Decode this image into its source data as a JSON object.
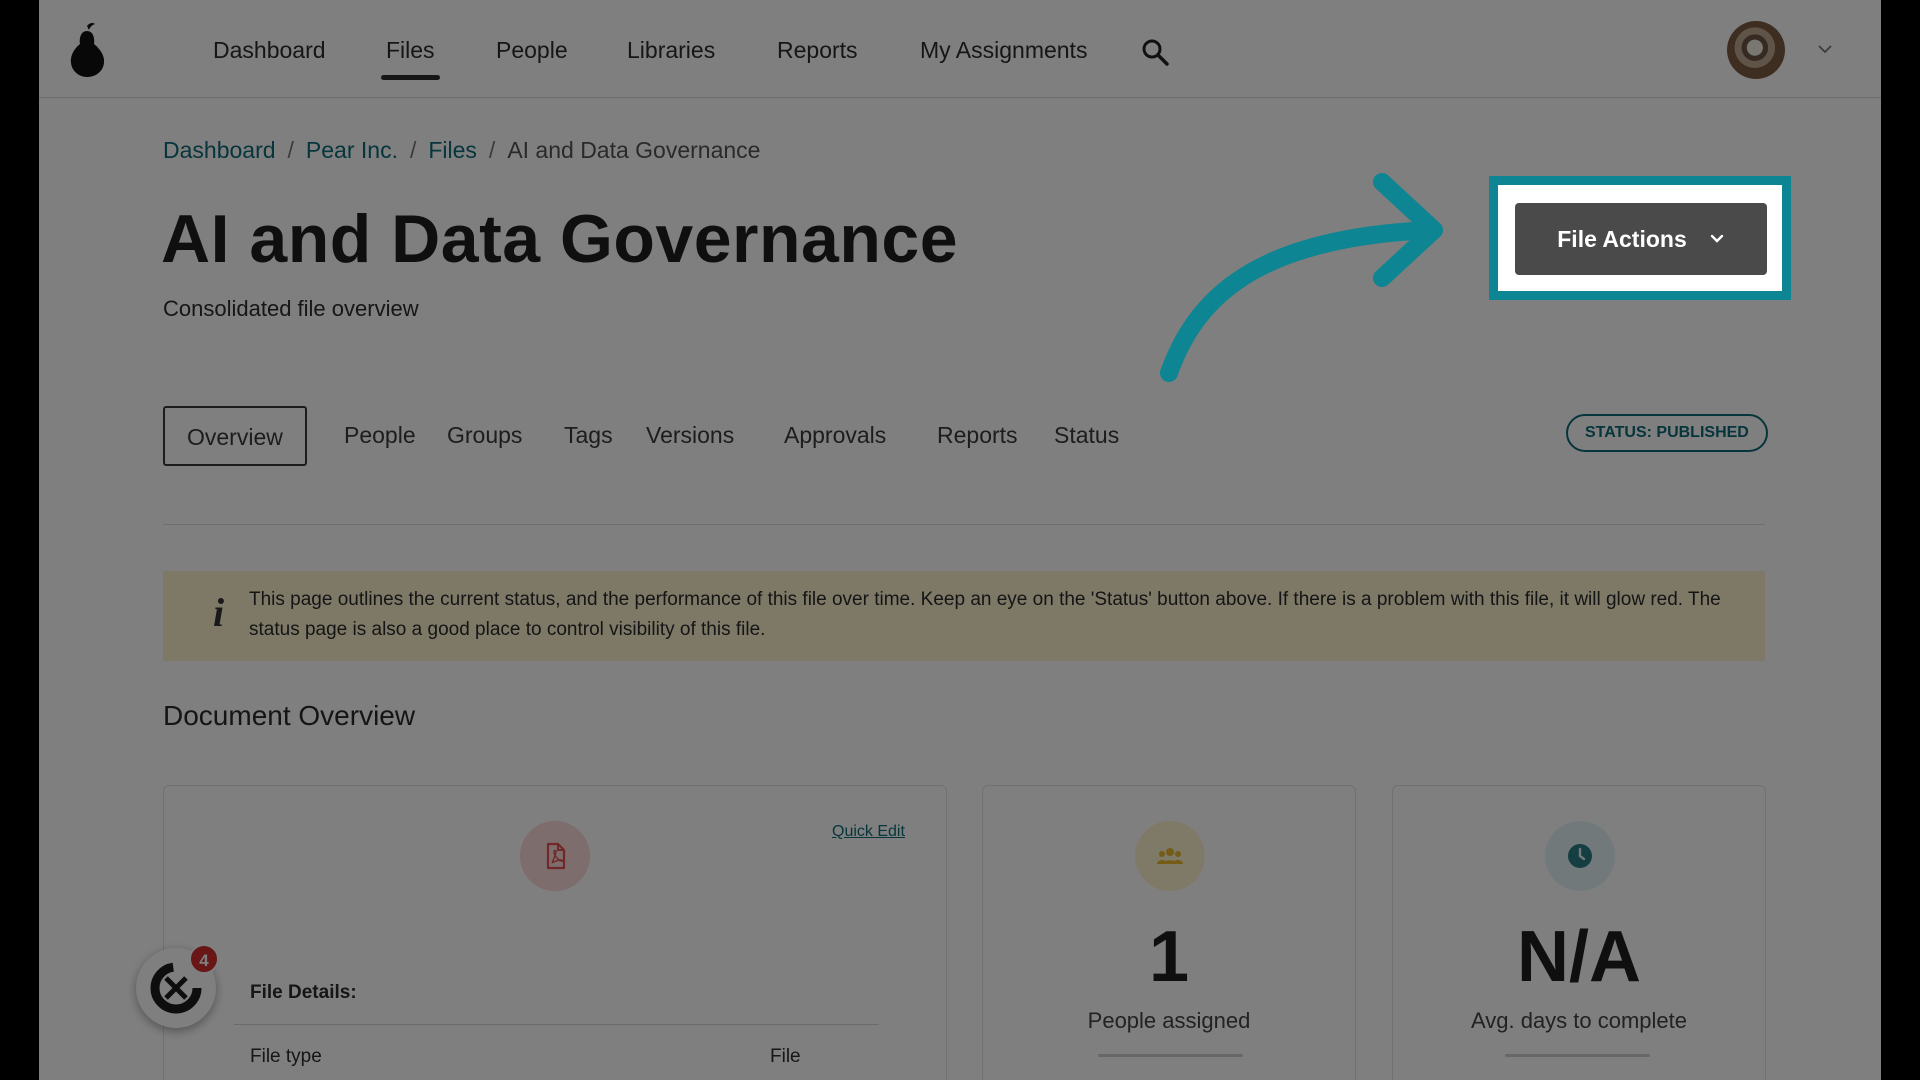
{
  "nav": {
    "items": [
      "Dashboard",
      "Files",
      "People",
      "Libraries",
      "Reports",
      "My Assignments"
    ],
    "active": "Files"
  },
  "breadcrumb": {
    "items": [
      "Dashboard",
      "Pear Inc.",
      "Files"
    ],
    "current": "AI and Data Governance",
    "separator": "/"
  },
  "header": {
    "title": "AI and Data Governance",
    "subtitle": "Consolidated file overview",
    "actions_button": "File Actions"
  },
  "tabs": [
    "Overview",
    "People",
    "Groups",
    "Tags",
    "Versions",
    "Approvals",
    "Reports",
    "Status"
  ],
  "active_tab": "Overview",
  "status_badge": "STATUS: PUBLISHED",
  "info_banner": {
    "icon": "i",
    "text": "This page outlines the current status, and the performance of this file over time. Keep an eye on the 'Status' button above. If there is a problem with this file, it will glow red. The status page is also a good place to control visibility of this file."
  },
  "section_title": "Document Overview",
  "file_card": {
    "quick_edit": "Quick Edit",
    "details_label": "File Details:",
    "file_type_label": "File type",
    "file_type_value": "File"
  },
  "people_card": {
    "value": "1",
    "label": "People assigned"
  },
  "days_card": {
    "value": "N/A",
    "label": "Avg. days to complete"
  },
  "help_widget": {
    "badge_count": "4"
  },
  "colors": {
    "accent": "#0e6b78",
    "highlight": "#0d8592",
    "button": "#4a4a4a",
    "banner": "#fdf3cf",
    "badge": "#d22d2d"
  }
}
